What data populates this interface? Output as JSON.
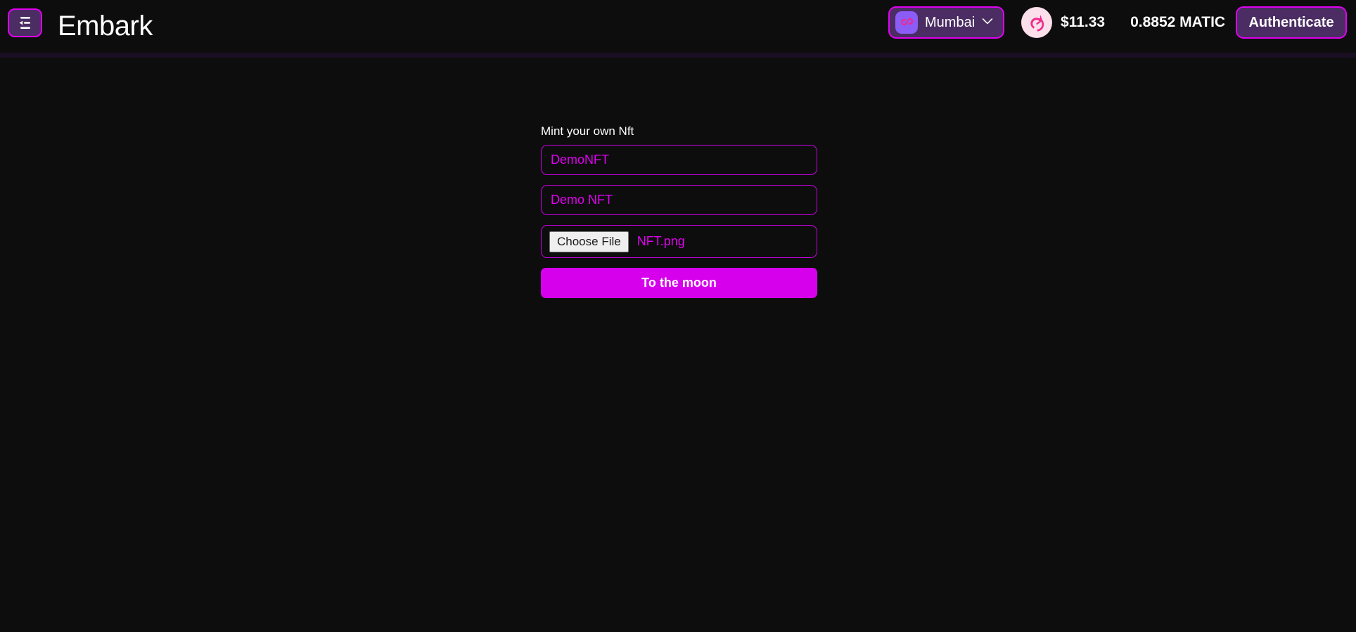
{
  "header": {
    "sidebar_toggle_icon": "menu-collapse-left-icon",
    "brand_title": "Embark",
    "network": {
      "logo_icon": "polygon-logo-icon",
      "name": "Mumbai",
      "chevron_icon": "chevron-down-icon"
    },
    "balance": {
      "token_avatar_icon": "unicorn-uniswap-icon",
      "usd_value": "$11.33",
      "token_amount": "0.8852 MATIC"
    },
    "authenticate_label": "Authenticate"
  },
  "main": {
    "form": {
      "label": "Mint your own Nft",
      "name_field": {
        "value": "DemoNFT",
        "placeholder": "DemoNFT"
      },
      "description_field": {
        "value": "Demo NFT",
        "placeholder": "Demo NFT"
      },
      "file_field": {
        "button_label": "Choose File",
        "file_name": "NFT.png"
      },
      "submit_label": "To the moon"
    }
  },
  "colors": {
    "background": "#0d0d0d",
    "accent_magenta": "#e000f0",
    "button_magenta": "#d600ec",
    "pill_purple": "#4b2d63",
    "divider": "#1a0f22"
  }
}
